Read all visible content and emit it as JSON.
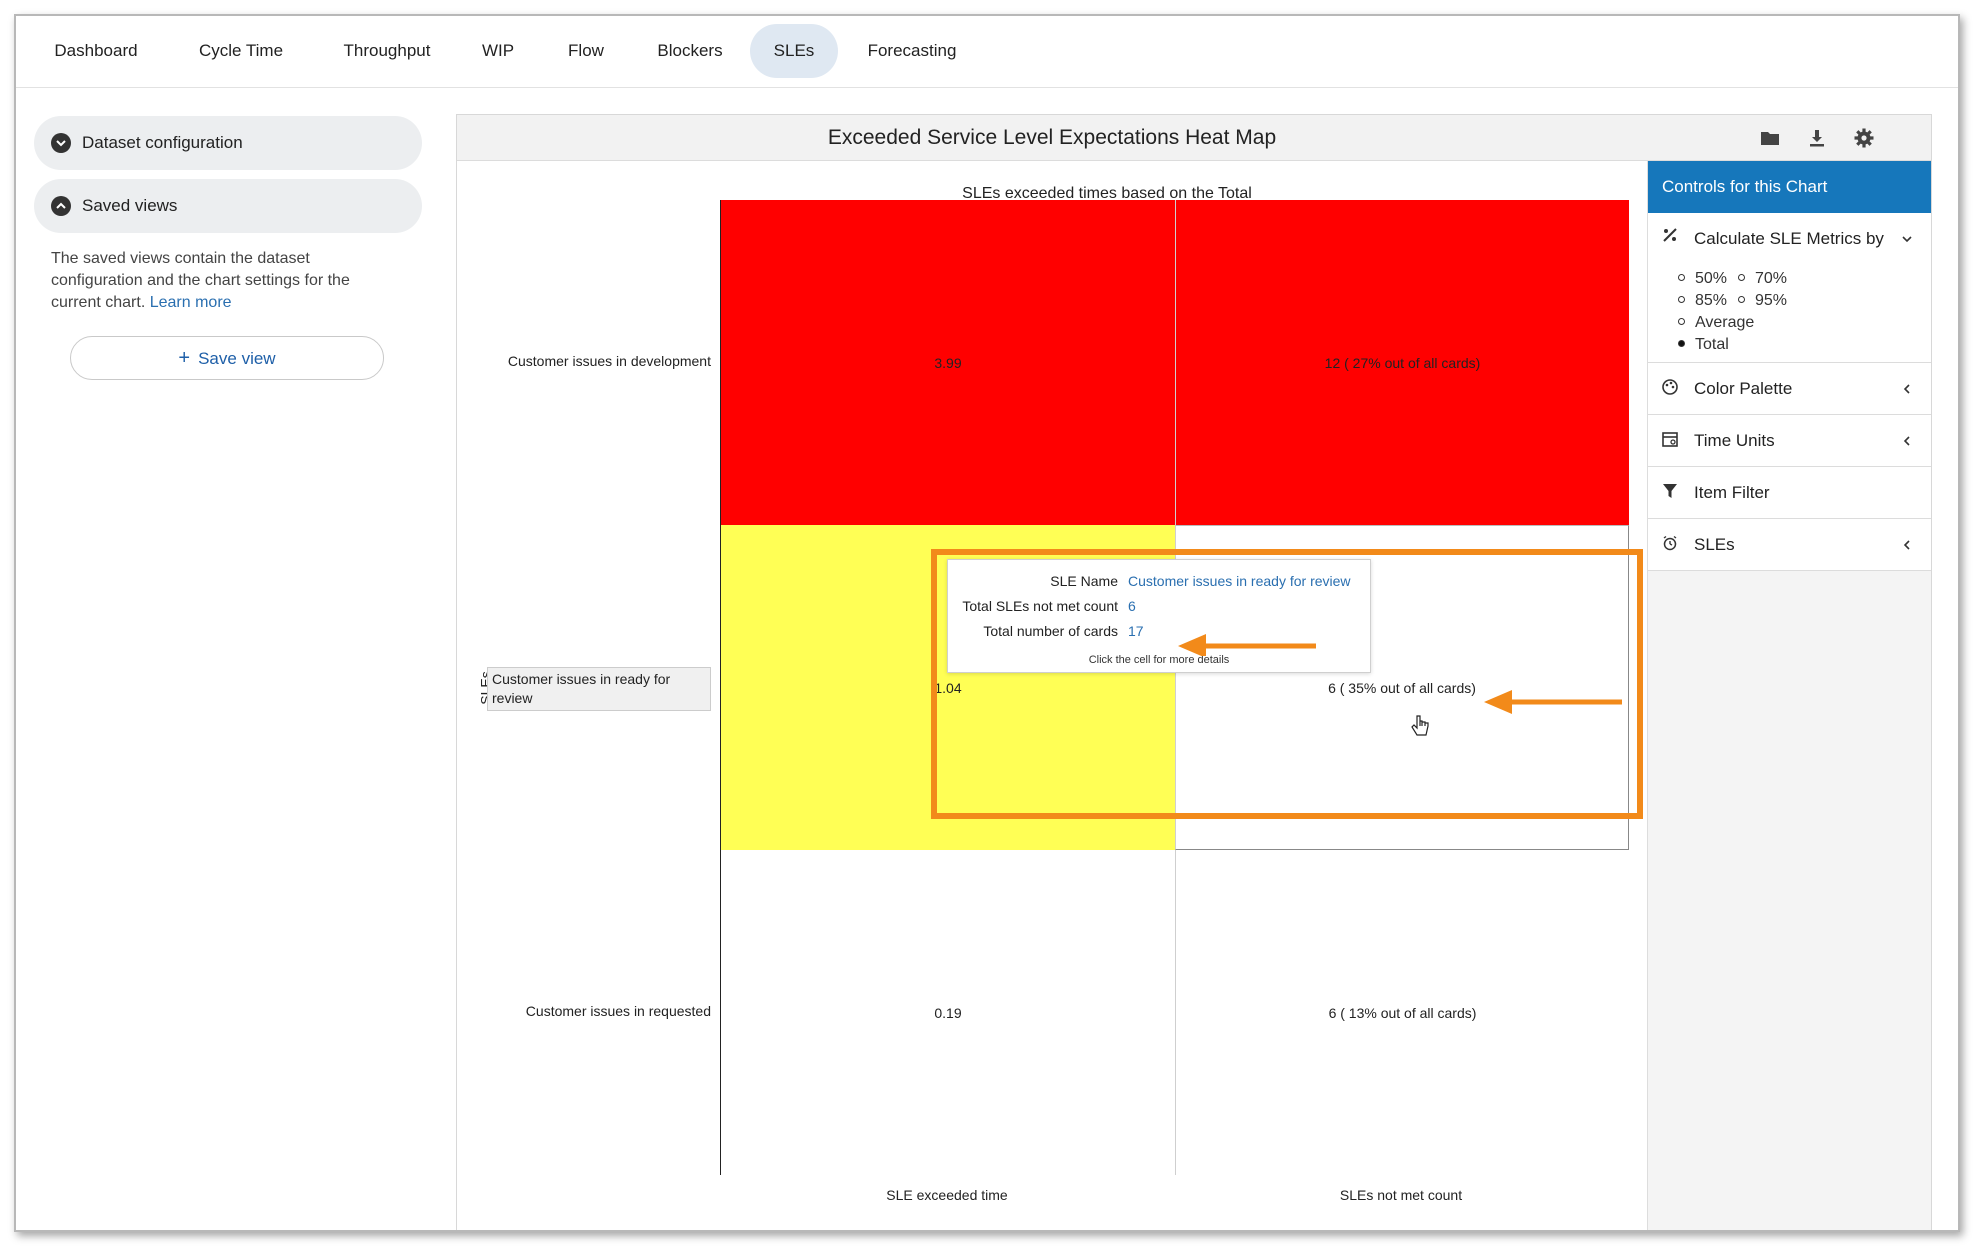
{
  "tabs": [
    {
      "label": "Dashboard"
    },
    {
      "label": "Cycle Time"
    },
    {
      "label": "Throughput"
    },
    {
      "label": "WIP"
    },
    {
      "label": "Flow"
    },
    {
      "label": "Blockers"
    },
    {
      "label": "SLEs",
      "active": true
    },
    {
      "label": "Forecasting"
    }
  ],
  "sidebar": {
    "dataset_label": "Dataset configuration",
    "saved_views_label": "Saved views",
    "description": "The saved views contain the dataset configuration and the chart settings for the current chart.",
    "learn_more": "Learn more",
    "save_view_label": "Save view"
  },
  "chart_panel": {
    "title": "Exceeded Service Level Expectations Heat Map",
    "icons": [
      "folder-icon",
      "download-icon",
      "gear-icon"
    ]
  },
  "controls": {
    "header": "Controls for this Chart",
    "calc_label": "Calculate SLE Metrics by",
    "options": [
      {
        "label": "50%",
        "selected": false
      },
      {
        "label": "70%",
        "selected": false
      },
      {
        "label": "85%",
        "selected": false
      },
      {
        "label": "95%",
        "selected": false
      },
      {
        "label": "Average",
        "selected": false
      },
      {
        "label": "Total",
        "selected": true
      }
    ],
    "color_palette": "Color Palette",
    "time_units": "Time Units",
    "item_filter": "Item Filter",
    "sles": "SLEs"
  },
  "chart_data": {
    "type": "heatmap",
    "title": "SLEs exceeded times based on the Total",
    "ylabel": "SLEs",
    "x_categories": [
      "SLE exceeded time",
      "SLEs not met count"
    ],
    "y_categories": [
      "Customer issues in development",
      "Customer issues in ready for review",
      "Customer issues in requested"
    ],
    "cells": [
      [
        "3.99",
        "12 ( 27% out of all cards)"
      ],
      [
        "1.04",
        "6 ( 35% out of all cards)"
      ],
      [
        "0.19",
        "6 ( 13% out of all cards)"
      ]
    ],
    "cell_colors": [
      [
        "#ff0000",
        "#ff0000"
      ],
      [
        "#ffff55",
        "#ffffff"
      ],
      [
        "#ffffff",
        "#ffffff"
      ]
    ]
  },
  "tooltip": {
    "sle_name_label": "SLE Name",
    "sle_name_value": "Customer issues in ready for review",
    "not_met_label": "Total SLEs not met count",
    "not_met_value": "6",
    "cards_label": "Total number of cards",
    "cards_value": "17",
    "hint": "Click the cell for more details"
  },
  "annotation_color": "#f28a1a"
}
